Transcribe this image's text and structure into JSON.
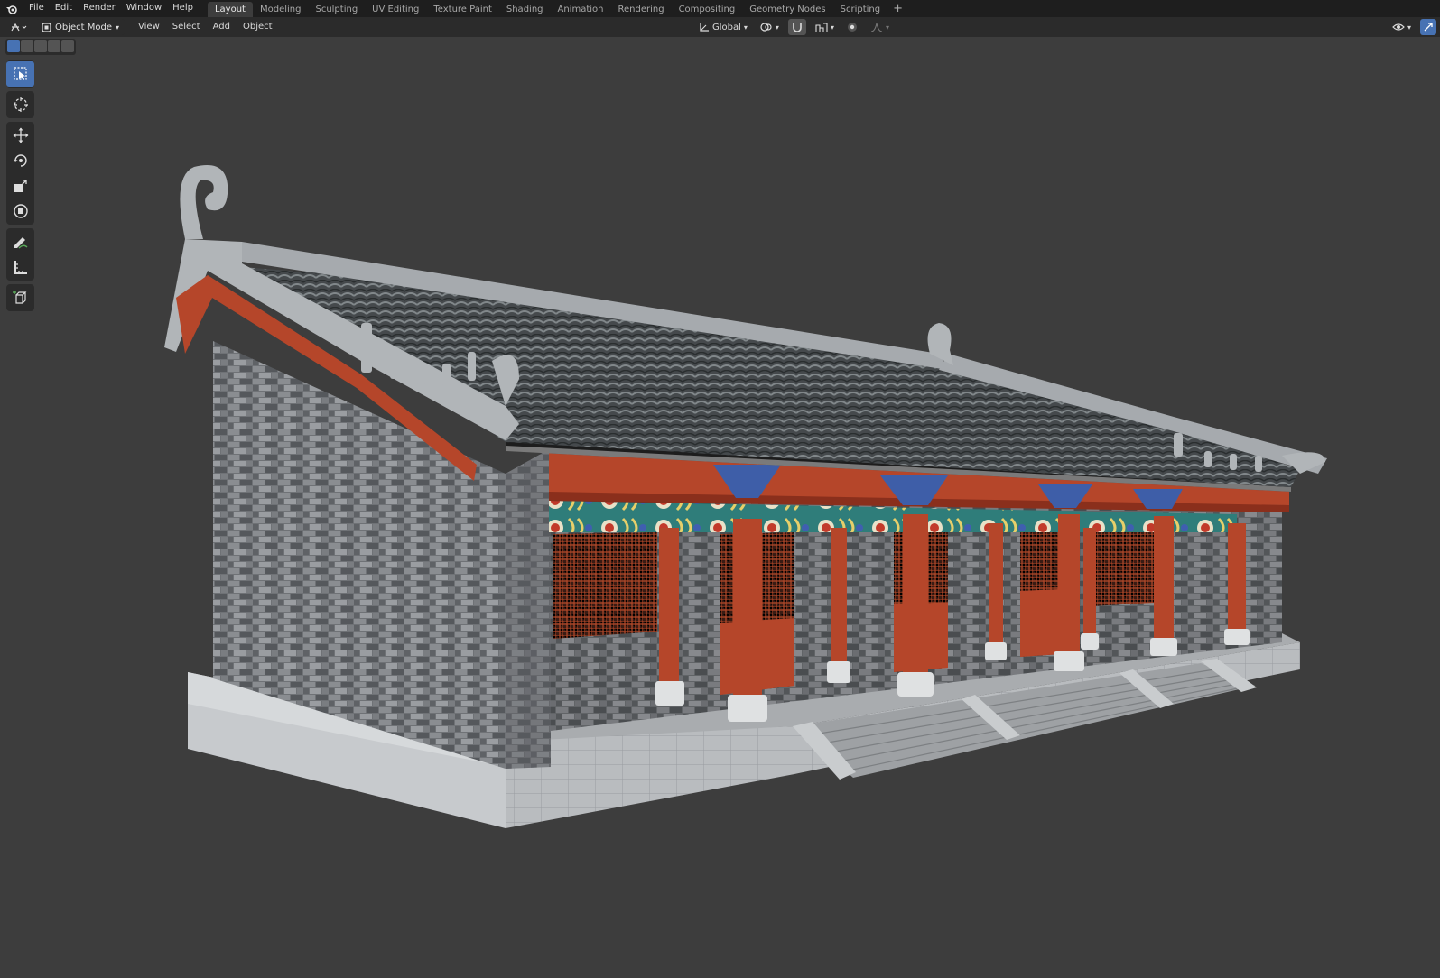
{
  "topbar": {
    "menus": [
      "File",
      "Edit",
      "Render",
      "Window",
      "Help"
    ],
    "workspaces": [
      "Layout",
      "Modeling",
      "Sculpting",
      "UV Editing",
      "Texture Paint",
      "Shading",
      "Animation",
      "Rendering",
      "Compositing",
      "Geometry Nodes",
      "Scripting"
    ],
    "active_workspace": "Layout",
    "add_label": "+"
  },
  "header": {
    "mode": "Object Mode",
    "menus": [
      "View",
      "Select",
      "Add",
      "Object"
    ],
    "transform_orientation": "Global"
  },
  "toolbar": {
    "tools": [
      "select-box",
      "cursor",
      "move",
      "rotate",
      "scale",
      "transform",
      "annotate",
      "measure",
      "add-cube"
    ],
    "active_tool": "select-box"
  },
  "colors": {
    "accent": "#4772b3",
    "viewport_bg": "#3d3d3d",
    "topbar_bg": "#1e1e1e",
    "header_bg": "#2b2b2b"
  }
}
